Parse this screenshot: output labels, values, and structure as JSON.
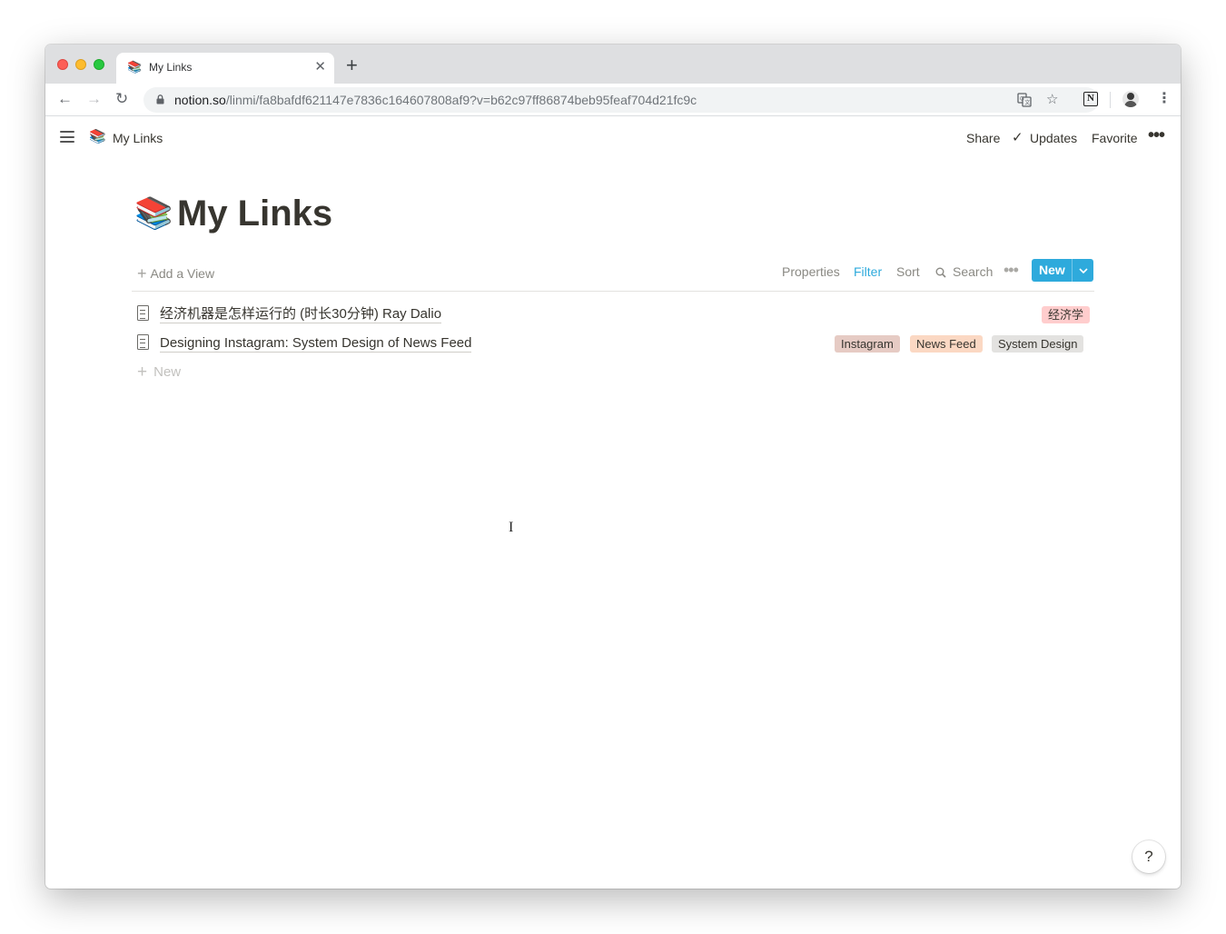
{
  "browser": {
    "tab_title": "My Links",
    "tab_favicon": "📚",
    "tab_close": "✕",
    "new_tab": "+",
    "nav_back": "←",
    "nav_forward": "→",
    "nav_reload": "↻",
    "url_host": "notion.so",
    "url_path": "/linmi/fa8bafdf621147e7836c164607808af9?v=b62c97ff86874beb95feaf704d21fc9c",
    "translate_icon": "translate-icon",
    "bookmark_star": "☆",
    "notion_extension": "N",
    "menu": "⋮"
  },
  "topbar": {
    "breadcrumb_icon": "📚",
    "breadcrumb_title": "My Links",
    "share": "Share",
    "updates_check": "✓",
    "updates": "Updates",
    "favorite": "Favorite",
    "more": "•••"
  },
  "page": {
    "emoji": "📚",
    "title": "My Links"
  },
  "viewbar": {
    "add_view_plus": "+",
    "add_view": "Add a View",
    "properties": "Properties",
    "filter": "Filter",
    "sort": "Sort",
    "search_icon": "⌕",
    "search": "Search",
    "more": "•••",
    "new": "New",
    "new_chevron": "⌄"
  },
  "rows": [
    {
      "title": "经济机器是怎样运行的 (时长30分钟) Ray Dalio",
      "tags": [
        "经济学"
      ]
    },
    {
      "title": "Designing Instagram: System Design of News Feed",
      "tags": [
        "Instagram",
        "News Feed",
        "System Design"
      ]
    }
  ],
  "add_row": {
    "plus": "+",
    "label": "New"
  },
  "cursor": "I",
  "help": "?",
  "colors": {
    "accent_blue": "#2eaadc",
    "tag_red": "#ffcdcd",
    "tag_brown": "#e6cbc4",
    "tag_orange": "#fbd8c3",
    "tag_gray": "#e3e2e0",
    "text": "#37352f"
  }
}
